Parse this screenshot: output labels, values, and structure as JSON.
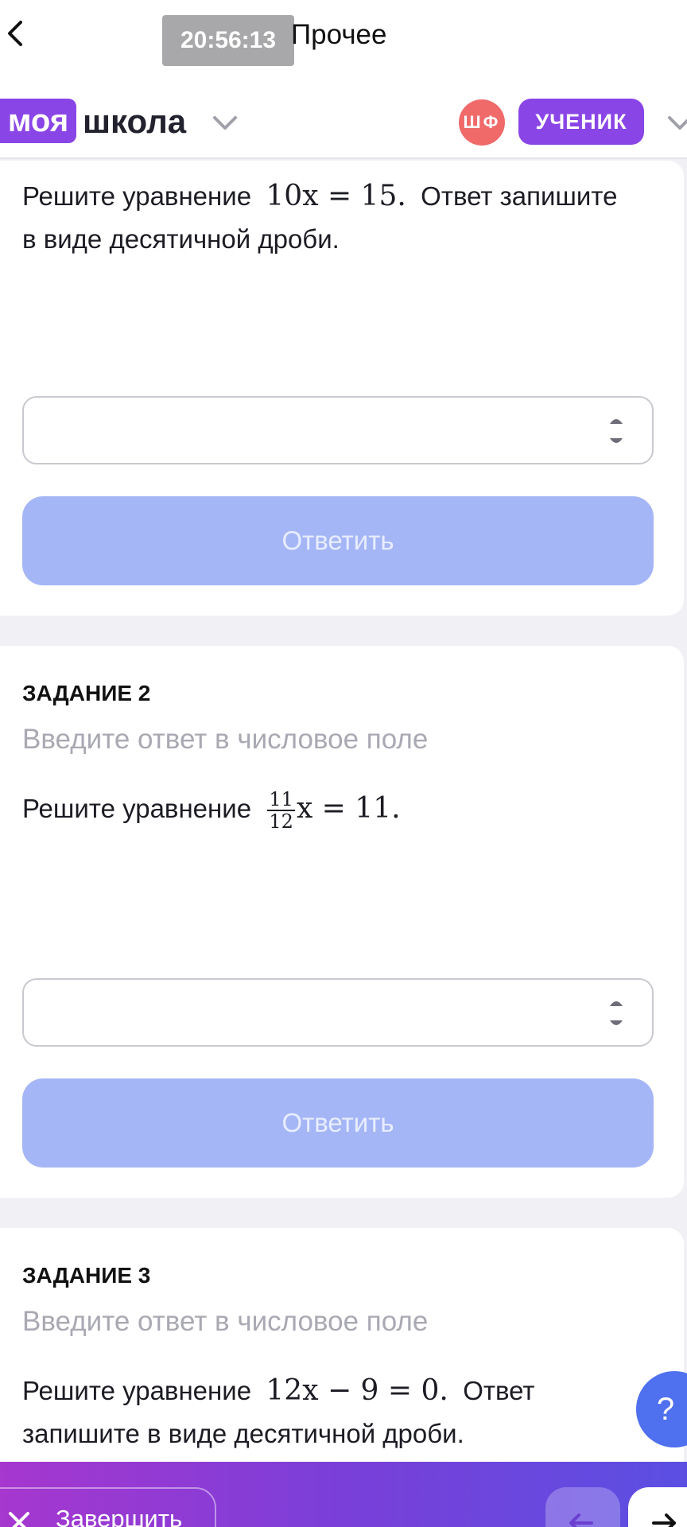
{
  "topbar": {
    "time": "20:56:13",
    "title": "Прочее"
  },
  "brand": {
    "part1": "моя",
    "part2": "школа",
    "avatar_initials": "ШФ",
    "role": "УЧЕНИК"
  },
  "tasks": [
    {
      "question_text": "Решите уравнение",
      "formula": "10x = 15.",
      "question_tail": "Ответ запишите",
      "question_line2": "в виде десятичной дроби.",
      "input_value": "",
      "answer_label": "Ответить"
    },
    {
      "title": "ЗАДАНИЕ 2",
      "hint": "Введите ответ в числовое поле",
      "question_text": "Решите уравнение",
      "fraction_num": "11",
      "fraction_den": "12",
      "formula_rest": "x = 11.",
      "input_value": "",
      "answer_label": "Ответить"
    },
    {
      "title": "ЗАДАНИЕ 3",
      "hint": "Введите ответ в числовое поле",
      "question_text": "Решите уравнение",
      "formula": "12x − 9 = 0.",
      "question_tail": "Ответ",
      "question_line2": "запишите в виде десятичной дроби."
    }
  ],
  "help_label": "?",
  "bottombar": {
    "finish_label": "Завершить"
  },
  "colors": {
    "brand_purple": "#8a45e6",
    "avatar_red": "#f06a6a",
    "answer_button": "#a5b6f7",
    "help_blue": "#4f70ef"
  },
  "icons": [
    "back-chevron-icon",
    "chevron-down-icon",
    "stepper-icon",
    "close-icon",
    "arrow-left-icon",
    "arrow-right-icon"
  ]
}
